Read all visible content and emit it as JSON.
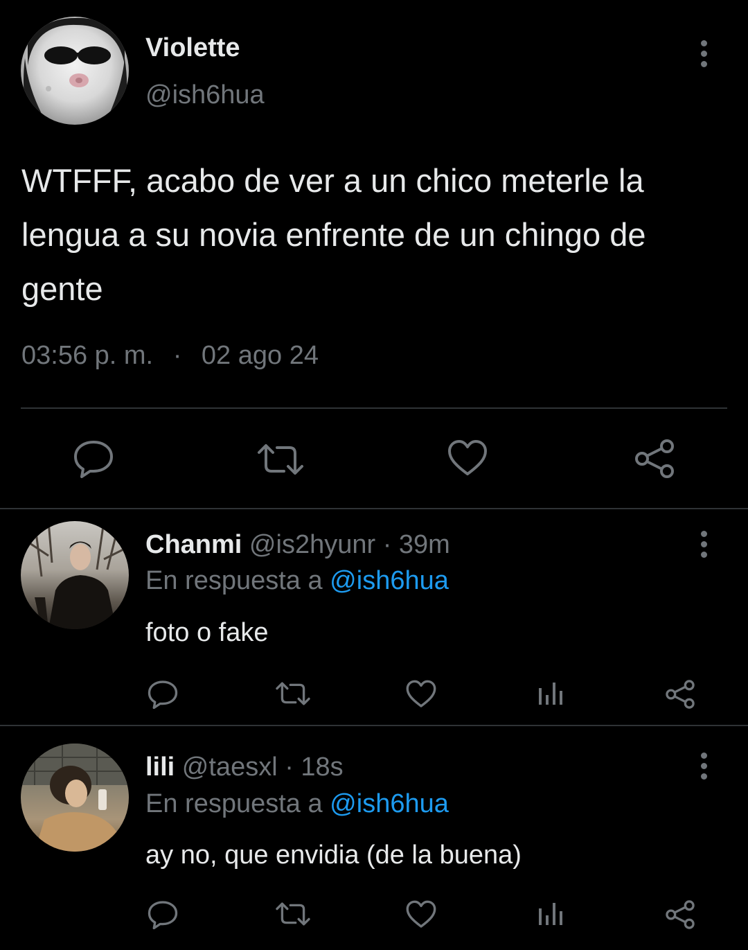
{
  "main_tweet": {
    "display_name": "Violette",
    "handle": "@ish6hua",
    "line1": "WTFFF, acabo de ver a un chico meterle la",
    "line2": "lengua a su novia enfrente de un chingo de",
    "line3": "gente",
    "time": "03:56 p. m.",
    "separator": "·",
    "date": "02 ago 24"
  },
  "replies": [
    {
      "display_name": "Chanmi",
      "handle": "@is2hyunr",
      "age": "· 39m",
      "reply_prefix": "En respuesta a",
      "reply_to": "@ish6hua",
      "text": "foto o fake"
    },
    {
      "display_name": "lili",
      "handle": "@taesxl",
      "age": "· 18s",
      "reply_prefix": "En respuesta a",
      "reply_to": "@ish6hua",
      "text": "ay no, que envidia (de la buena)"
    }
  ],
  "icons": {
    "action_bar": [
      "reply-icon",
      "retweet-icon",
      "like-icon",
      "share-icon"
    ],
    "reply_action_bar": [
      "reply-icon",
      "retweet-icon",
      "like-icon",
      "views-icon",
      "share-icon"
    ],
    "menu": "more-options-icon"
  },
  "colors": {
    "background": "#000000",
    "text": "#e7e9ea",
    "secondary": "#71767b",
    "link": "#1d9bf0",
    "divider": "#2f3336"
  }
}
